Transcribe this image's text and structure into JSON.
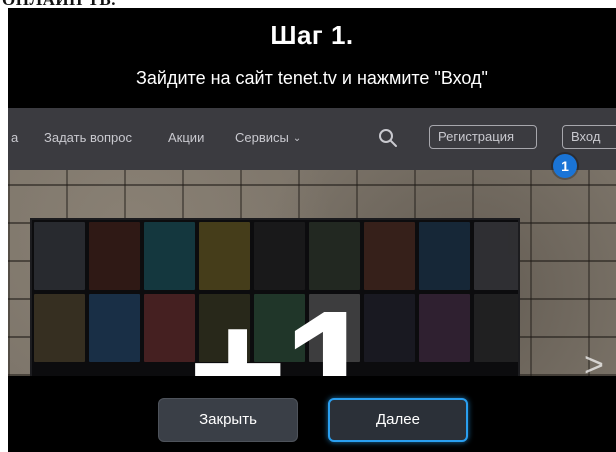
{
  "page_heading_fragment": "ОНЛАЙН ТВ.",
  "dialog": {
    "title": "Шаг 1.",
    "instruction": "Зайдите на сайт tenet.tv и нажмите \"Вход\""
  },
  "site_preview": {
    "nav": {
      "partial_item": "а",
      "links": [
        "Задать вопрос",
        "Акции",
        "Сервисы"
      ],
      "services_dropdown_icon": "chevron-down-icon",
      "search_icon": "search-icon",
      "register_label": "Регистрация",
      "login_label": "Вход"
    },
    "step_badge": "1",
    "promo_text": "+1",
    "next_arrow": ">"
  },
  "buttons": {
    "close_label": "Закрыть",
    "next_label": "Далее"
  },
  "colors": {
    "accent": "#2a9ff0",
    "badge": "#1a74d6",
    "nav_bg": "#3b3b40"
  }
}
